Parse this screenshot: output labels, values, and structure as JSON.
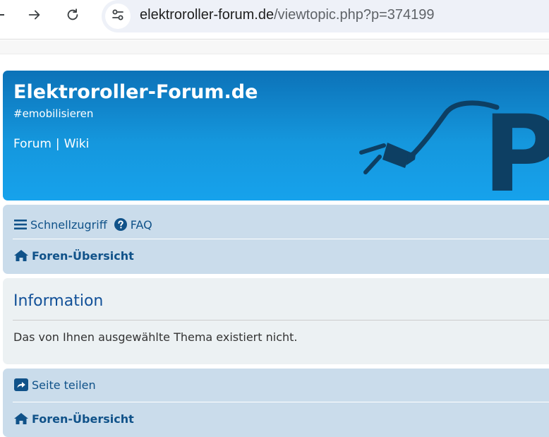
{
  "browser": {
    "url_host": "elektroroller-forum.de",
    "url_path": "/viewtopic.php?p=374199",
    "icons": {
      "forward": "arrow-right-icon",
      "reload": "reload-icon",
      "site_info": "tune-icon"
    }
  },
  "header": {
    "title": "Elektroroller-Forum.de",
    "tagline": "#emobilisieren",
    "nav": [
      {
        "label": "Forum"
      },
      {
        "label": "Wiki"
      }
    ],
    "nav_separator": "|",
    "logo_letter": "P"
  },
  "navbar_top": {
    "quick_access": "Schnellzugriff",
    "faq": "FAQ",
    "forum_index": "Foren-Übersicht"
  },
  "info": {
    "title": "Information",
    "message": "Das von Ihnen ausgewählte Thema existiert nicht."
  },
  "navbar_bottom": {
    "share": "Seite teilen",
    "forum_index": "Foren-Übersicht"
  },
  "colors": {
    "header_top": "#0c72b8",
    "header_bottom": "#16a2ec",
    "navbar_bg": "#cadceb",
    "info_bg": "#ecf1f3",
    "link": "#105289",
    "title": "#115098",
    "logo_dark": "#0d3f63"
  }
}
